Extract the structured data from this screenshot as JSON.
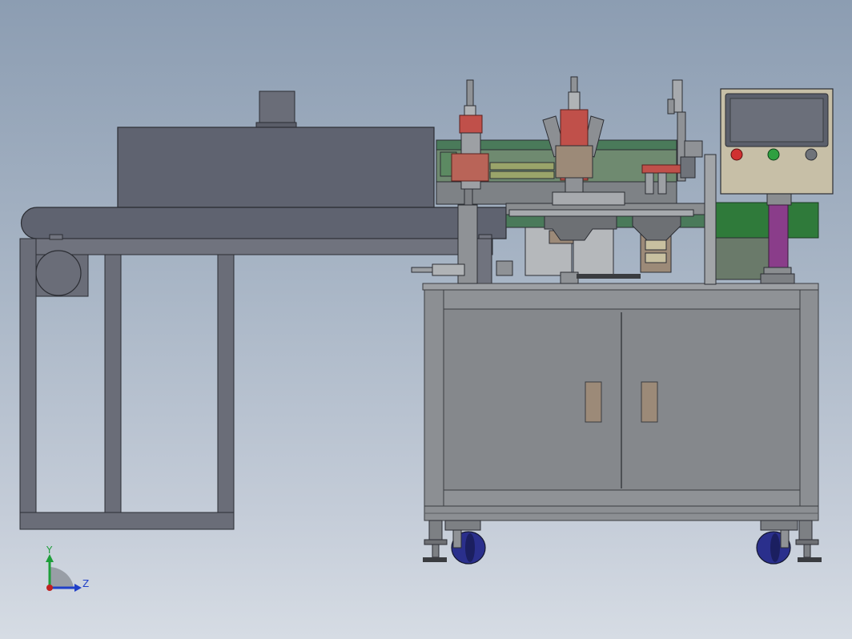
{
  "triad": {
    "y_label": "Y",
    "z_label": "Z",
    "y_color": "#1e9e3a",
    "z_color": "#2040c8",
    "origin_color": "#c02020"
  },
  "colors": {
    "frame_gray": "#8a8d90",
    "dark_steel": "#5b5f6b",
    "machine_blue_gray": "#60636e",
    "red_part": "#c0504a",
    "green_panel": "#2f7a3a",
    "caster_blue": "#2a2f8c",
    "purple_column": "#8a3d8a",
    "panel_beige": "#cfc6b0"
  }
}
